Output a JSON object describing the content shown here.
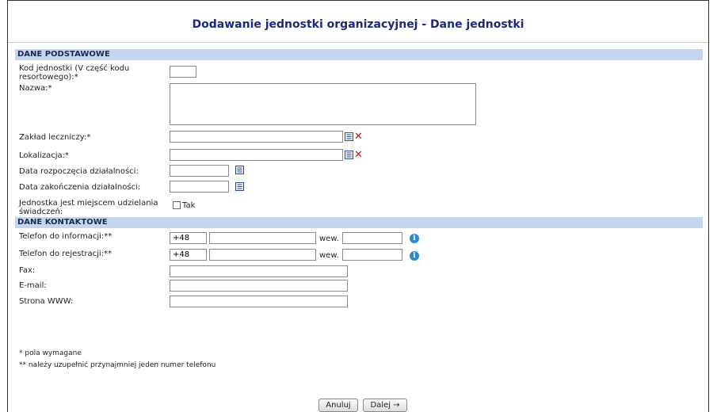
{
  "title": "Dodawanie jednostki organizacyjnej - Dane jednostki",
  "sections": {
    "basic": "DANE PODSTAWOWE",
    "contact": "DANE KONTAKTOWE"
  },
  "basic": {
    "kod_label_line1": "Kod jednostki (V część kodu",
    "kod_label_line2": "resortowego):*",
    "kod_value": "",
    "nazwa_label": "Nazwa:*",
    "nazwa_value": "",
    "zaklad_label": "Zakład leczniczy:*",
    "zaklad_value": "",
    "lokalizacja_label": "Lokalizacja:*",
    "lokalizacja_value": "",
    "data_rozp_label": "Data rozpoczęcia działalności:",
    "data_rozp_value": "",
    "data_zak_label": "Data zakończenia działalności:",
    "data_zak_value": "",
    "miejsce_label_line1": "Jednostka jest miejscem udzielania",
    "miejsce_label_line2": "świadczeń:",
    "miejsce_checkbox_label": "Tak",
    "miejsce_checked": false
  },
  "contact": {
    "tel_info_label": "Telefon do informacji:**",
    "tel_info_prefix": "+48",
    "tel_info_number": "",
    "tel_info_wew_label": "wew.",
    "tel_info_wew": "",
    "tel_rej_label": "Telefon do rejestracji:**",
    "tel_rej_prefix": "+48",
    "tel_rej_number": "",
    "tel_rej_wew_label": "wew.",
    "tel_rej_wew": "",
    "fax_label": "Fax:",
    "fax_value": "",
    "email_label": "E-mail:",
    "email_value": "",
    "www_label": "Strona WWW:",
    "www_value": ""
  },
  "notes": {
    "required": "*  pola wymagane",
    "phone": "** należy uzupełnić przynajmniej jeden numer telefonu"
  },
  "buttons": {
    "cancel": "Anuluj",
    "next": "Dalej →"
  },
  "colors": {
    "section_bg": "#c6d5ee",
    "title": "#1a2a7a",
    "remove_icon": "#d01010",
    "info_icon": "#2a8ad8"
  }
}
